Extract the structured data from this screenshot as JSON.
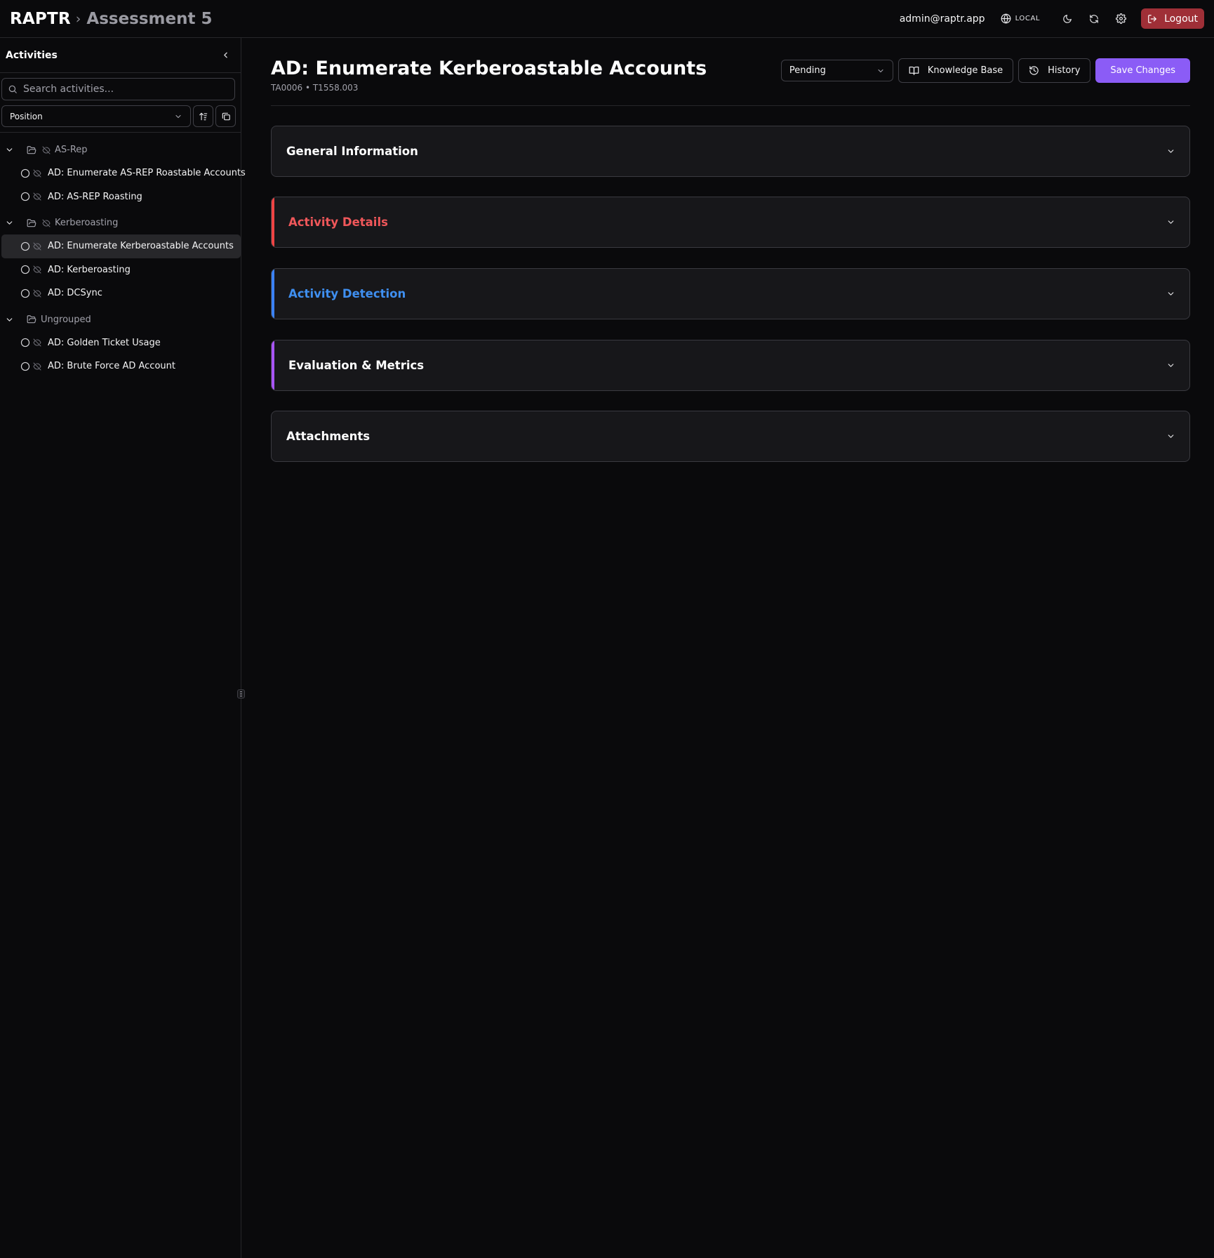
{
  "header": {
    "brand": "RAPTR",
    "separator": "›",
    "current": "Assessment 5",
    "user_email": "admin@raptr.app",
    "environment": "LOCAL",
    "logout_label": "Logout"
  },
  "sidebar": {
    "title": "Activities",
    "search_placeholder": "Search activities...",
    "sort_value": "Position",
    "groups": [
      {
        "name": "AS-Rep",
        "expanded": true,
        "items": [
          {
            "label": "AD: Enumerate AS-REP Roastable Accounts",
            "active": false
          },
          {
            "label": "AD: AS-REP Roasting",
            "active": false
          }
        ]
      },
      {
        "name": "Kerberoasting",
        "expanded": true,
        "items": [
          {
            "label": "AD: Enumerate Kerberoastable Accounts",
            "active": true
          },
          {
            "label": "AD: Kerberoasting",
            "active": false
          },
          {
            "label": "AD: DCSync",
            "active": false
          }
        ]
      },
      {
        "name": "Ungrouped",
        "expanded": true,
        "items": [
          {
            "label": "AD: Golden Ticket Usage",
            "active": false
          },
          {
            "label": "AD: Brute Force AD Account",
            "active": false
          }
        ]
      }
    ]
  },
  "main": {
    "title": "AD: Enumerate Kerberoastable Accounts",
    "subtitle": "TA0006 • T1558.003",
    "status_value": "Pending",
    "knowledge_base_label": "Knowledge Base",
    "history_label": "History",
    "save_label": "Save Changes",
    "sections": [
      {
        "title": "General Information",
        "title_color": "#ffffff",
        "accent": null
      },
      {
        "title": "Activity Details",
        "title_color": "#f0575a",
        "accent": "#ef4444"
      },
      {
        "title": "Activity Detection",
        "title_color": "#3f8ff0",
        "accent": "#3b82f6"
      },
      {
        "title": "Evaluation & Metrics",
        "title_color": "#ffffff",
        "accent": "#a855f7"
      },
      {
        "title": "Attachments",
        "title_color": "#ffffff",
        "accent": null
      }
    ]
  },
  "colors": {
    "background": "#0a0a0c",
    "panel": "#17171a",
    "primary": "#8b5cf6",
    "logout": "#9f2f37"
  }
}
